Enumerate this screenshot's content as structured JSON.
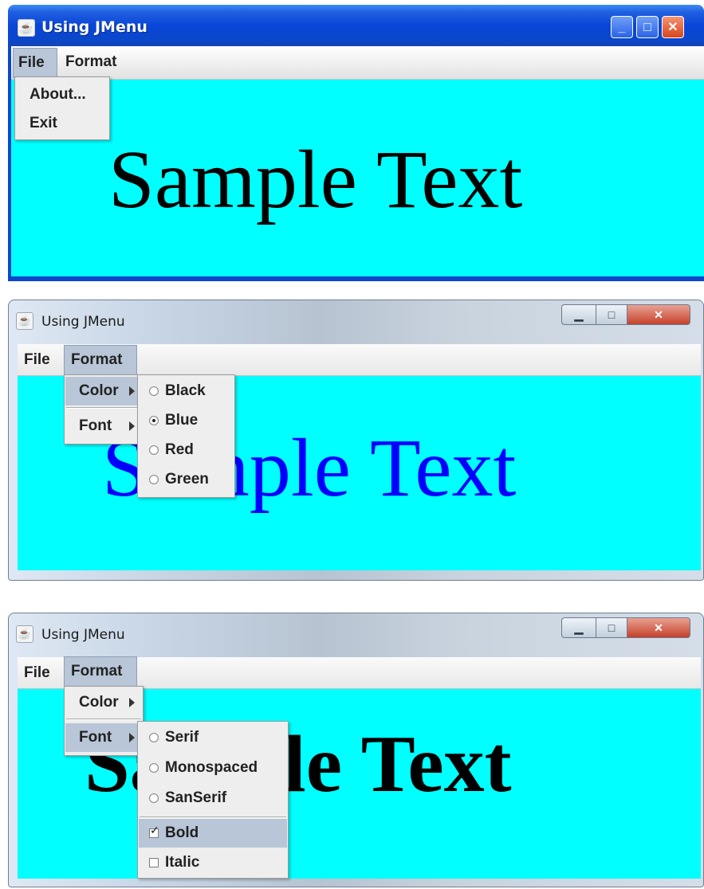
{
  "windows": [
    {
      "title": "Using JMenu",
      "menubar": {
        "file": "File",
        "format": "Format"
      },
      "file_menu": {
        "items": [
          "About...",
          "Exit"
        ]
      },
      "sample_text": "Sample Text",
      "text_color": "#000000",
      "background_color": "#00ffff"
    },
    {
      "title": "Using JMenu",
      "menubar": {
        "file": "File",
        "format": "Format"
      },
      "format_menu": {
        "color": "Color",
        "font": "Font"
      },
      "color_menu": {
        "items": [
          "Black",
          "Blue",
          "Red",
          "Green"
        ],
        "selected": "Blue"
      },
      "sample_text": "Sample Text",
      "text_color": "#0000ff",
      "background_color": "#00ffff"
    },
    {
      "title": "Using JMenu",
      "menubar": {
        "file": "File",
        "format": "Format"
      },
      "format_menu": {
        "color": "Color",
        "font": "Font"
      },
      "font_menu": {
        "fonts": [
          "Serif",
          "Monospaced",
          "SanSerif"
        ],
        "styles": [
          "Bold",
          "Italic"
        ],
        "bold_checked": true,
        "italic_checked": false
      },
      "sample_text": "Sample Text",
      "text_color": "#000000",
      "background_color": "#00ffff"
    }
  ],
  "icons": {
    "app": "java-cup-icon",
    "minimize": "minimize-icon",
    "maximize": "maximize-icon",
    "close": "close-icon",
    "submenu": "submenu-arrow-icon"
  }
}
